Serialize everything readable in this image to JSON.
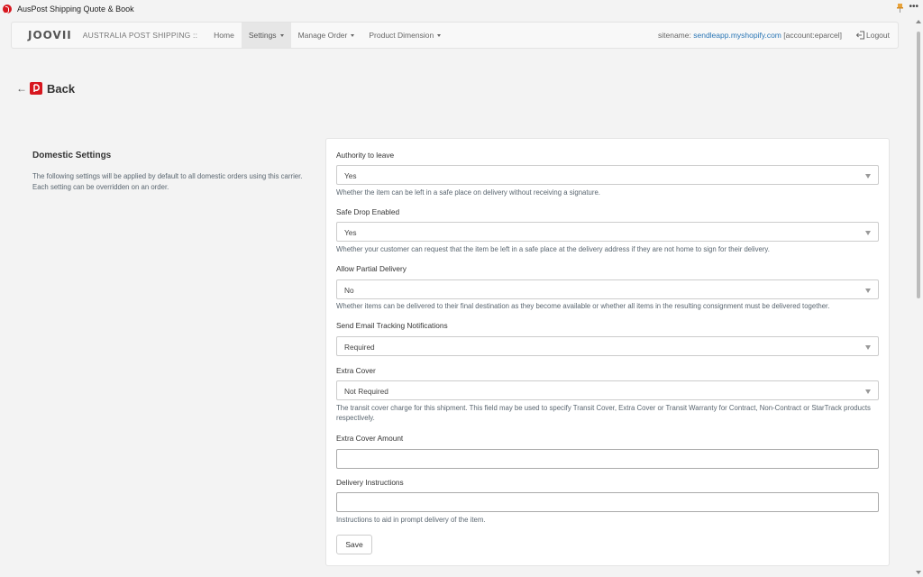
{
  "window": {
    "title": "AusPost Shipping Quote & Book",
    "more_label": "•••"
  },
  "navbar": {
    "brand": "JOOVII",
    "app_name": "AUSTRALIA POST SHIPPING ::",
    "items": [
      {
        "label": "Home"
      },
      {
        "label": "Settings"
      },
      {
        "label": "Manage Order"
      },
      {
        "label": "Product Dimension"
      }
    ],
    "sitename_label": "sitename:",
    "sitename_value": "sendleapp.myshopify.com",
    "account": "[account:eparcel]",
    "logout_label": "Logout"
  },
  "back": {
    "arrow": "←",
    "label": "Back"
  },
  "section": {
    "title": "Domestic Settings",
    "description": "The following settings will be applied by default to all domestic orders using this carrier. Each setting can be overridden on an order."
  },
  "form": {
    "authority": {
      "label": "Authority to leave",
      "value": "Yes",
      "help": "Whether the item can be left in a safe place on delivery without receiving a signature."
    },
    "safe_drop": {
      "label": "Safe Drop Enabled",
      "value": "Yes",
      "help": "Whether your customer can request that the item be left in a safe place at the delivery address if they are not home to sign for their delivery."
    },
    "partial_delivery": {
      "label": "Allow Partial Delivery",
      "value": "No",
      "help": "Whether items can be delivered to their final destination as they become available or whether all items in the resulting consignment must be delivered together."
    },
    "email_tracking": {
      "label": "Send Email Tracking Notifications",
      "value": "Required"
    },
    "extra_cover": {
      "label": "Extra Cover",
      "value": "Not Required",
      "help": "The transit cover charge for this shipment. This field may be used to specify Transit Cover, Extra Cover or Transit Warranty for Contract, Non-Contract or StarTrack products respectively."
    },
    "extra_cover_amount": {
      "label": "Extra Cover Amount",
      "value": ""
    },
    "delivery_instructions": {
      "label": "Delivery Instructions",
      "value": "",
      "help": "Instructions to aid in prompt delivery of the item."
    },
    "save_label": "Save"
  },
  "colors": {
    "brand_red": "#d7171f",
    "link_blue": "#2a76b5"
  }
}
